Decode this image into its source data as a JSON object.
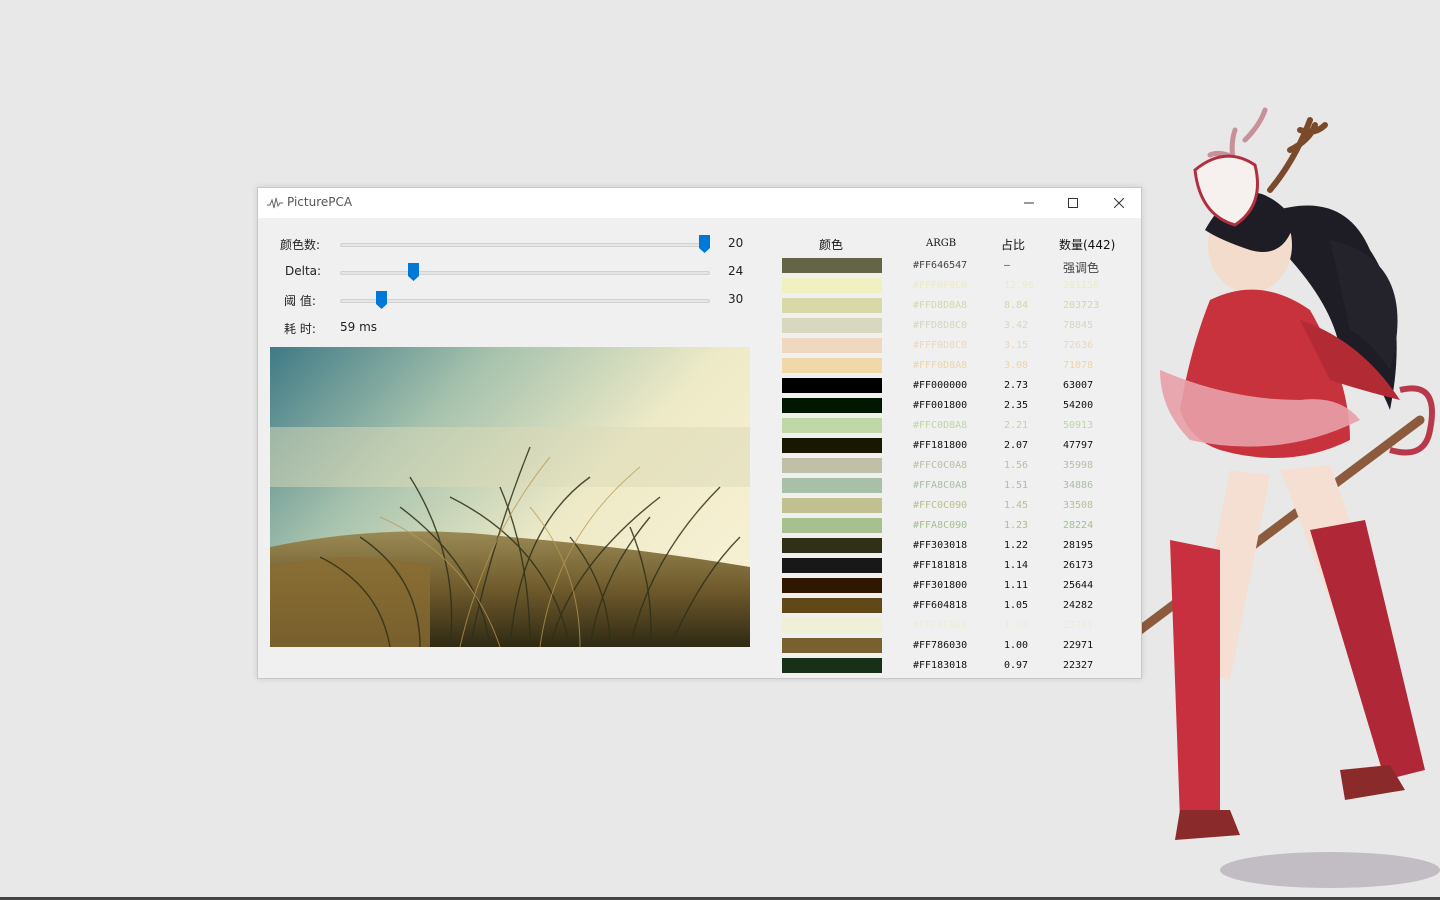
{
  "window": {
    "title": "PicturePCA"
  },
  "controls": {
    "color_count": {
      "label": "颜色数:",
      "value": "20",
      "fraction": 1.0
    },
    "delta": {
      "label": "Delta:",
      "value": "24",
      "fraction": 0.19
    },
    "threshold": {
      "label": "阈  值:",
      "value": "30",
      "fraction": 0.1
    },
    "elapsed": {
      "label": "耗  时:",
      "value": "59 ms"
    }
  },
  "table": {
    "headers": {
      "color": "颜色",
      "argb": "ARGB",
      "ratio": "占比",
      "count": "数量(442)"
    },
    "rows": [
      {
        "swatch": "#646547",
        "argb": "#FF646547",
        "ratio": "–",
        "count": "强调色",
        "text_color": "#444444"
      },
      {
        "swatch": "#F0F0C0",
        "argb": "#FFF0F0C0",
        "ratio": "12.96",
        "count": "281150",
        "text_color": "#ECECC0"
      },
      {
        "swatch": "#D8D8A8",
        "argb": "#FFD8D8A8",
        "ratio": "8.84",
        "count": "203723",
        "text_color": "#D6D6A8"
      },
      {
        "swatch": "#D8D8C0",
        "argb": "#FFD8D8C0",
        "ratio": "3.42",
        "count": "78845",
        "text_color": "#D6D6C0"
      },
      {
        "swatch": "#F0D8C0",
        "argb": "#FFF0D8C0",
        "ratio": "3.15",
        "count": "72636",
        "text_color": "#EBD6C0"
      },
      {
        "swatch": "#F0D8A8",
        "argb": "#FFF0D8A8",
        "ratio": "3.08",
        "count": "71078",
        "text_color": "#EBD6A8"
      },
      {
        "swatch": "#000000",
        "argb": "#FF000000",
        "ratio": "2.73",
        "count": "63007",
        "text_color": "#111111"
      },
      {
        "swatch": "#001800",
        "argb": "#FF001800",
        "ratio": "2.35",
        "count": "54200",
        "text_color": "#111111"
      },
      {
        "swatch": "#C0D8A8",
        "argb": "#FFC0D8A8",
        "ratio": "2.21",
        "count": "50913",
        "text_color": "#BED6A8"
      },
      {
        "swatch": "#181800",
        "argb": "#FF181800",
        "ratio": "2.07",
        "count": "47797",
        "text_color": "#111111"
      },
      {
        "swatch": "#C0C0A8",
        "argb": "#FFC0C0A8",
        "ratio": "1.56",
        "count": "35998",
        "text_color": "#BDBDA6"
      },
      {
        "swatch": "#A8C0A8",
        "argb": "#FFA8C0A8",
        "ratio": "1.51",
        "count": "34886",
        "text_color": "#A8BFA8"
      },
      {
        "swatch": "#C0C090",
        "argb": "#FFC0C090",
        "ratio": "1.45",
        "count": "33508",
        "text_color": "#BDBD90"
      },
      {
        "swatch": "#A8C090",
        "argb": "#FFA8C090",
        "ratio": "1.23",
        "count": "28224",
        "text_color": "#A6BF90"
      },
      {
        "swatch": "#303018",
        "argb": "#FF303018",
        "ratio": "1.22",
        "count": "28195",
        "text_color": "#111111"
      },
      {
        "swatch": "#181818",
        "argb": "#FF181818",
        "ratio": "1.14",
        "count": "26173",
        "text_color": "#111111"
      },
      {
        "swatch": "#301800",
        "argb": "#FF301800",
        "ratio": "1.11",
        "count": "25644",
        "text_color": "#111111"
      },
      {
        "swatch": "#604818",
        "argb": "#FF604818",
        "ratio": "1.05",
        "count": "24282",
        "text_color": "#111111"
      },
      {
        "swatch": "#F0F0D8",
        "argb": "#FFF0F0D8",
        "ratio": "1.03",
        "count": "23741",
        "text_color": "#ECECD6"
      },
      {
        "swatch": "#786030",
        "argb": "#FF786030",
        "ratio": "1.00",
        "count": "22971",
        "text_color": "#111111"
      },
      {
        "swatch": "#183018",
        "argb": "#FF183018",
        "ratio": "0.97",
        "count": "22327",
        "text_color": "#111111"
      }
    ]
  },
  "icons": {
    "app": "waveform-icon",
    "minimize": "minimize-icon",
    "maximize": "maximize-icon",
    "close": "close-icon"
  },
  "colors": {
    "accent": "#0078D7",
    "window_bg": "#F0F0F0",
    "titlebar_bg": "#FFFFFF",
    "desktop_bg": "#E8E8E8"
  }
}
